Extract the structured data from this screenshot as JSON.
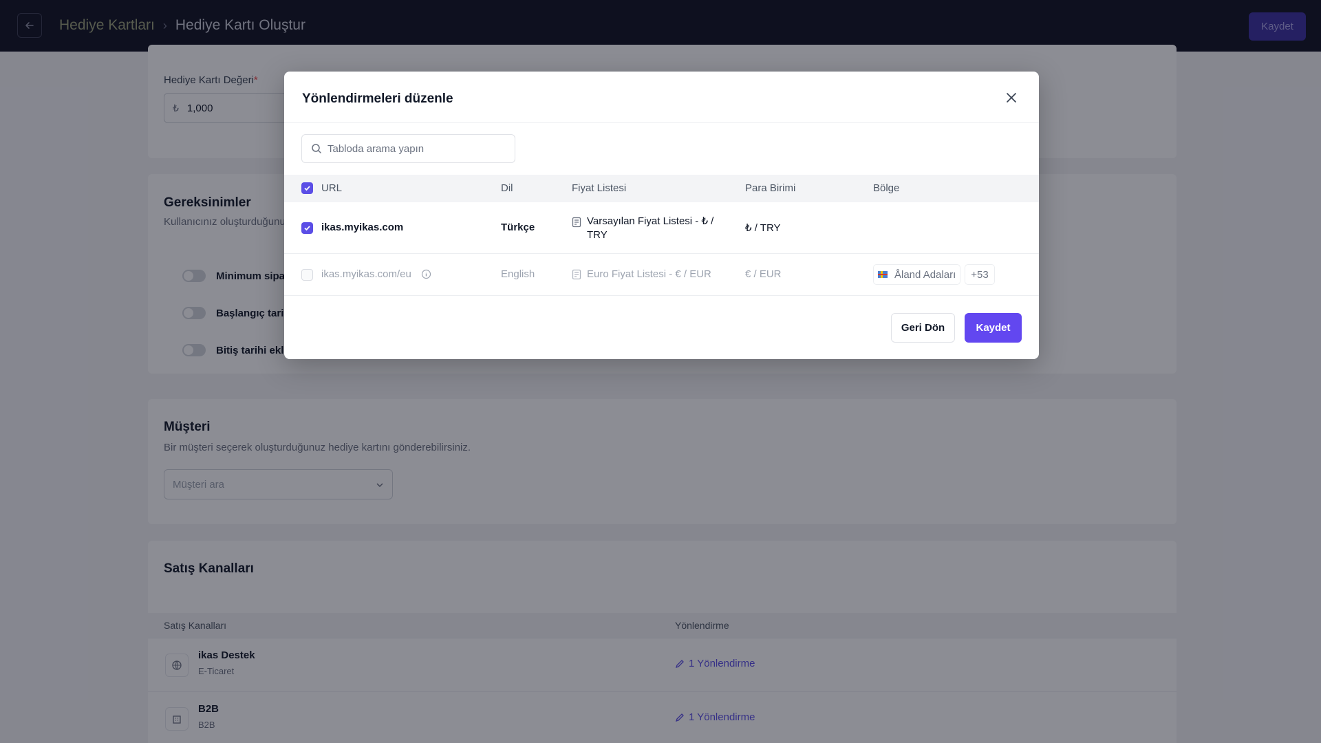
{
  "header": {
    "breadcrumb_parent": "Hediye Kartları",
    "breadcrumb_current": "Hediye Kartı Oluştur",
    "save_label": "Kaydet"
  },
  "gift_card": {
    "value_label": "Hediye Kartı Değeri",
    "required_mark": "*",
    "currency_symbol": "₺",
    "value": "1,000"
  },
  "requirements": {
    "title": "Gereksinimler",
    "subtitle": "Kullanıcınız oluşturduğunu",
    "toggles": [
      "Minimum sipar",
      "Başlangıç tarih",
      "Bitiş tarihi ekle"
    ]
  },
  "customer": {
    "title": "Müşteri",
    "subtitle": "Bir müşteri seçerek oluşturduğunuz hediye kartını gönderebilirsiniz.",
    "select_placeholder": "Müşteri ara"
  },
  "sales_channels": {
    "title": "Satış Kanalları",
    "col_channels": "Satış Kanalları",
    "col_redirect": "Yönlendirme",
    "rows": [
      {
        "name": "ikas Destek",
        "type": "E-Ticaret",
        "redirect": "1 Yönlendirme",
        "icon": "globe-icon"
      },
      {
        "name": "B2B",
        "type": "B2B",
        "redirect": "1 Yönlendirme",
        "icon": "building-icon"
      }
    ]
  },
  "modal": {
    "title": "Yönlendirmeleri düzenle",
    "search_placeholder": "Tabloda arama yapın",
    "columns": {
      "url": "URL",
      "language": "Dil",
      "price_list": "Fiyat Listesi",
      "currency": "Para Birimi",
      "region": "Bölge"
    },
    "rows": [
      {
        "checked": true,
        "url": "ikas.myikas.com",
        "language": "Türkçe",
        "price_list_line1": "Varsayılan Fiyat Listesi - ₺ /",
        "price_list_line2": "TRY",
        "currency": "₺ / TRY",
        "region": "",
        "region_more": ""
      },
      {
        "checked": false,
        "disabled": true,
        "url": "ikas.myikas.com/eu",
        "language": "English",
        "price_list_line1": "Euro Fiyat Listesi - € / EUR",
        "currency": "€ / EUR",
        "region": "Åland Adaları",
        "region_more": "+53"
      }
    ],
    "back_label": "Geri Dön",
    "save_label": "Kaydet"
  },
  "colors": {
    "accent": "#6247f0",
    "header_bg": "#0f1020"
  }
}
